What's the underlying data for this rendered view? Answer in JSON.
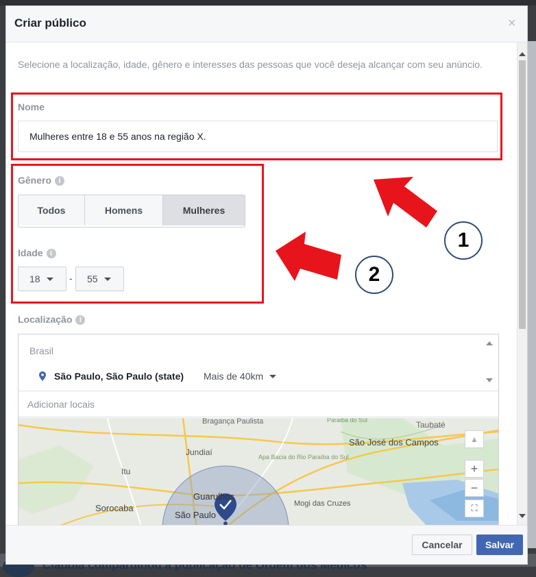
{
  "dialog": {
    "title": "Criar público",
    "close_glyph": "×",
    "intro": "Selecione a localização, idade, gênero e interesses das pessoas que você deseja alcançar com seu anúncio."
  },
  "name": {
    "label": "Nome",
    "value": "Mulheres entre 18 e 55 anos na região X."
  },
  "gender": {
    "label": "Gênero",
    "options": [
      "Todos",
      "Homens",
      "Mulheres"
    ],
    "selected": "Mulheres"
  },
  "age": {
    "label": "Idade",
    "min": "18",
    "max": "55",
    "separator": "-"
  },
  "location": {
    "label": "Localização",
    "country": "Brasil",
    "city": "São Paulo, São Paulo (state)",
    "radius": "Mais de 40km",
    "add_placeholder": "Adicionar locais"
  },
  "map": {
    "labels": [
      "Bragança Paulista",
      "Jundiaí",
      "Itu",
      "Sorocaba",
      "São Paulo",
      "Guarulhos",
      "Mogi das Cruzes",
      "São José dos Campos",
      "Taubaté",
      "Paraiba do Sul",
      "Apa Bacia do Rio Paraíba do Sul"
    ],
    "zoom_in": "+",
    "zoom_out": "−"
  },
  "footer": {
    "cancel_label": "Cancelar",
    "save_label": "Salvar"
  },
  "annotations": {
    "callout_1": "1",
    "callout_2": "2"
  },
  "background": {
    "post_text": "Claudia compartilhou a publicação de Ordem dos Médicos"
  },
  "colors": {
    "highlight": "#e8141b",
    "primary_button": "#4267b2",
    "circle_border": "#2f4a74"
  }
}
